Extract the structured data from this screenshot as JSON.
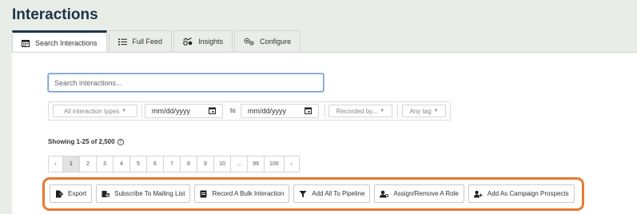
{
  "page": {
    "title": "Interactions"
  },
  "tabs": [
    {
      "label": "Search Interactions",
      "icon": "calendar-icon",
      "active": true
    },
    {
      "label": "Full Feed",
      "icon": "list-icon"
    },
    {
      "label": "Insights",
      "icon": "insights-icon"
    },
    {
      "label": "Configure",
      "icon": "gears-icon"
    }
  ],
  "search": {
    "placeholder": "Search interactions..."
  },
  "filters": {
    "types": "All interaction types",
    "date_from": "mm/dd/yyyy",
    "to_label": "to",
    "date_to": "mm/dd/yyyy",
    "recorded_by": "Recorded by...",
    "tag": "Any tag"
  },
  "results": {
    "showing": "Showing 1-25 of 2,500"
  },
  "pagination": {
    "prev": "‹",
    "pages": [
      "1",
      "2",
      "3",
      "4",
      "5",
      "6",
      "7",
      "8",
      "9",
      "10",
      "...",
      "99",
      "100"
    ],
    "next": "›",
    "current": "1"
  },
  "actions": [
    {
      "label": "Export",
      "icon": "export-icon"
    },
    {
      "label": "Subscribe To Mailing List",
      "icon": "subscribe-icon"
    },
    {
      "label": "Record A Bulk Interaction",
      "icon": "record-icon"
    },
    {
      "label": "Add All To Pipeline",
      "icon": "funnel-icon"
    },
    {
      "label": "Assign/Remove A Role",
      "icon": "user-role-icon"
    },
    {
      "label": "Add As Campaign Prospects",
      "icon": "campaign-icon"
    }
  ],
  "colors": {
    "title": "#1c3446",
    "highlight": "#e87a2f",
    "focus": "#6c9bd0"
  }
}
